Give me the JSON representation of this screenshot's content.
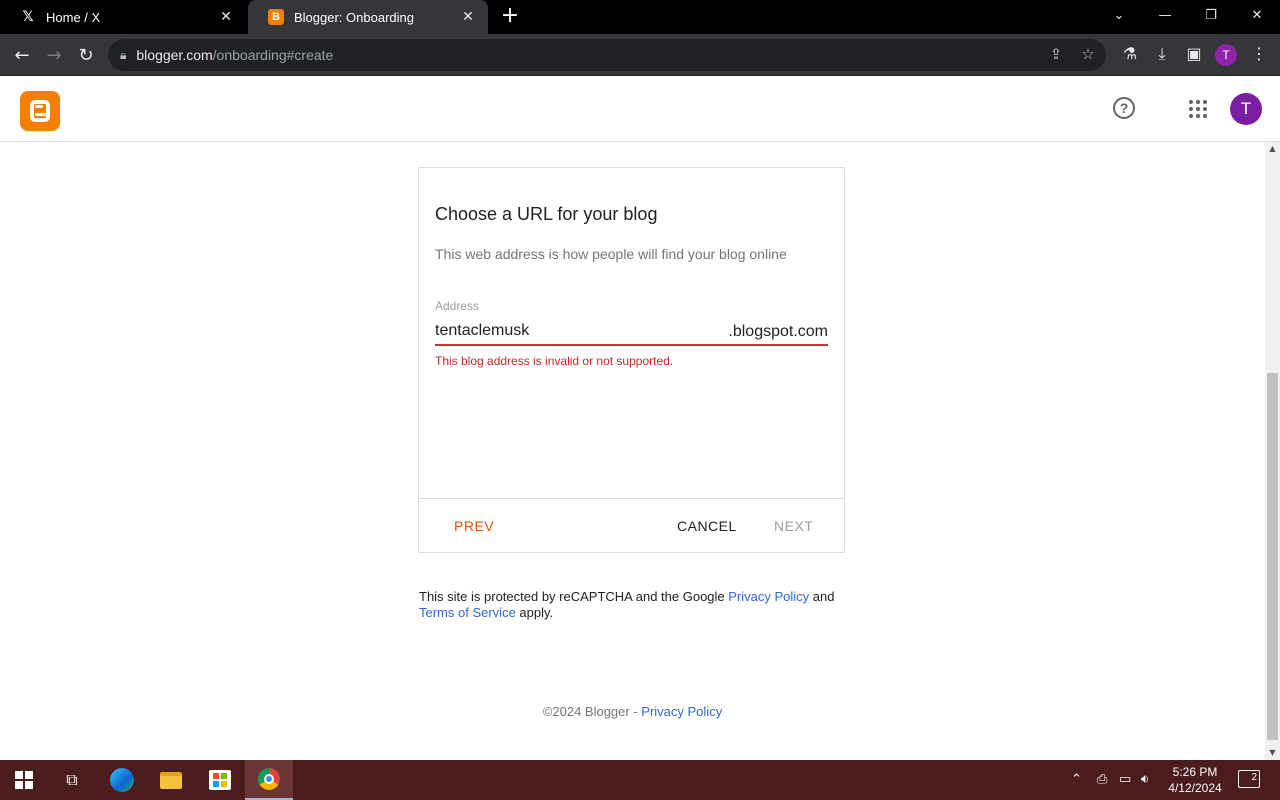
{
  "browser": {
    "tabs": [
      {
        "label": "Home / X",
        "icon": "x-logo-icon"
      },
      {
        "label": "Blogger: Onboarding",
        "icon": "blogger-favicon-icon"
      }
    ],
    "url_host": "blogger.com",
    "url_path": "/onboarding#create",
    "profile_initial": "T"
  },
  "app": {
    "avatar_initial": "T",
    "brand_color": "#f57d00"
  },
  "dialog": {
    "title": "Choose a URL for your blog",
    "description": "This web address is how people will find your blog online",
    "field_label": "Address",
    "field_value": "tentaclemusk",
    "field_suffix": ".blogspot.com",
    "error": "This blog address is invalid or not supported.",
    "buttons": {
      "prev": "PREV",
      "cancel": "CANCEL",
      "next": "NEXT"
    }
  },
  "recaptcha": {
    "text1": "This site is protected by reCAPTCHA and the Google ",
    "privacy": "Privacy Policy",
    "and": " and",
    "terms": "Terms of Service",
    "apply": " apply."
  },
  "footer": {
    "copyright": "©2024 Blogger - ",
    "privacy": "Privacy Policy"
  },
  "taskbar": {
    "time": "5:26 PM",
    "date": "4/12/2024",
    "notification_count": "2"
  }
}
